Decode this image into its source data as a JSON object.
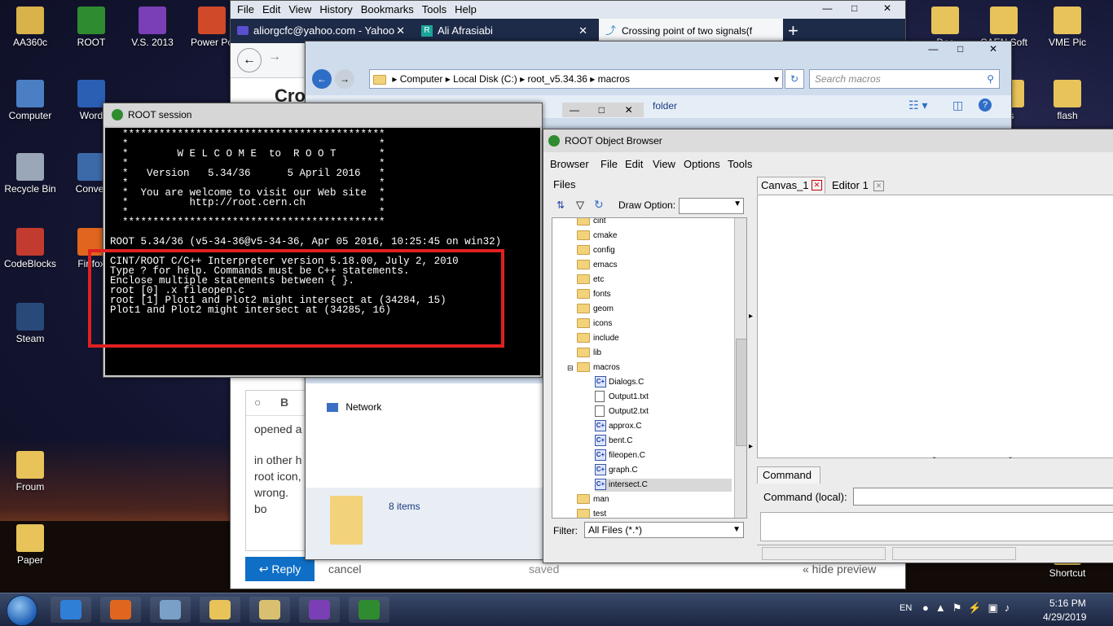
{
  "desktop": {
    "left_icons": [
      {
        "label": "AA360c",
        "color": "#d9b24a"
      },
      {
        "label": "Computer",
        "color": "#4b7fc4"
      },
      {
        "label": "Recycle Bin",
        "color": "#9aa7b8"
      },
      {
        "label": "CodeBlocks",
        "color": "#c23b2e"
      },
      {
        "label": "Steam",
        "color": "#274a7a"
      },
      {
        "label": "Froum",
        "color": "#e7c35a"
      },
      {
        "label": "Paper",
        "color": "#e7c35a"
      }
    ],
    "second_col_icons": [
      {
        "label": "ROOT",
        "color": "#2f8b2f"
      },
      {
        "label": "Word",
        "color": "#2b5fb4"
      },
      {
        "label": "Conver",
        "color": "#3c6aa8"
      },
      {
        "label": "Fir fox",
        "color": "#e0661f"
      }
    ],
    "third_col_icons": [
      {
        "label": "V.S. 2013",
        "color": "#7a3fb4"
      },
      {
        "label": "Power Po",
        "color": "#d04a2a"
      }
    ],
    "right_icons": [
      {
        "label": "Doc",
        "color": "#e7c35a"
      },
      {
        "label": "CAEN Soft",
        "color": "#e7c35a"
      },
      {
        "label": "VME Pic",
        "color": "#e7c35a"
      },
      {
        "label": "flash",
        "color": "#e7c35a"
      },
      {
        "label": "is",
        "color": "#e7c35a"
      },
      {
        "label": "Shortcut",
        "color": "#e7c35a"
      }
    ]
  },
  "taskbar": {
    "lang": "EN",
    "time": "5:16 PM",
    "date": "4/29/2019",
    "apps": [
      {
        "name": "ie-icon",
        "color": "#2f7fd6"
      },
      {
        "name": "firefox-icon",
        "color": "#e0661f"
      },
      {
        "name": "calculator-icon",
        "color": "#7aa0c8"
      },
      {
        "name": "file-explorer-icon",
        "color": "#e7c35a"
      },
      {
        "name": "folders-icon",
        "color": "#d9c070"
      },
      {
        "name": "visual-studio-icon",
        "color": "#7a3fb4"
      },
      {
        "name": "root-tree-icon",
        "color": "#2f8b2f"
      }
    ]
  },
  "browser": {
    "menu": [
      "File",
      "Edit",
      "View",
      "History",
      "Bookmarks",
      "Tools",
      "Help"
    ],
    "tabs": [
      {
        "title": "aliorgcfc@yahoo.com - Yahoo"
      },
      {
        "title": "Ali Afrasiabi"
      },
      {
        "title": "Crossing point of two signals(f"
      }
    ],
    "new_tab": "+",
    "page_title": "Cro",
    "editor_lines": [
      "opened a",
      "in other h",
      "root icon,",
      "wrong. bo"
    ],
    "reply_label": "Reply",
    "cancel_label": "cancel",
    "saved_label": "saved",
    "hide_preview": "« hide preview"
  },
  "explorer": {
    "breadcrumb": [
      "Computer",
      "Local Disk (C:)",
      "root_v5.34.36",
      "macros"
    ],
    "search_placeholder": "Search macros",
    "folder_label": "folder",
    "network_label": "Network",
    "items_count": "8 items"
  },
  "root_session": {
    "title": "ROOT session",
    "banner": [
      "  *******************************************",
      "  *                                         *",
      "  *        W E L C O M E  to  R O O T       *",
      "  *                                         *",
      "  *   Version   5.34/36      5 April 2016   *",
      "  *                                         *",
      "  *  You are welcome to visit our Web site  *",
      "  *          http://root.cern.ch            *",
      "  *                                         *",
      "  *******************************************"
    ],
    "version_line": "ROOT 5.34/36 (v5-34-36@v5-34-36, Apr 05 2016, 10:25:45 on win32)",
    "output": [
      "CINT/ROOT C/C++ Interpreter version 5.18.00, July 2, 2010",
      "Type ? for help. Commands must be C++ statements.",
      "Enclose multiple statements between { }.",
      "root [0] .x fileopen.c",
      "root [1] Plot1 and Plot2 might intersect at (34284, 15)",
      "Plot1 and Plot2 might intersect at (34285, 16)"
    ]
  },
  "object_browser": {
    "title": "ROOT Object Browser",
    "menu": [
      "Browser",
      "File",
      "Edit",
      "View",
      "Options",
      "Tools"
    ],
    "files_tab": "Files",
    "draw_option_label": "Draw Option:",
    "tree": [
      {
        "label": "cint",
        "type": "folder",
        "depth": 1
      },
      {
        "label": "cmake",
        "type": "folder",
        "depth": 1
      },
      {
        "label": "config",
        "type": "folder",
        "depth": 1
      },
      {
        "label": "emacs",
        "type": "folder",
        "depth": 1
      },
      {
        "label": "etc",
        "type": "folder",
        "depth": 1
      },
      {
        "label": "fonts",
        "type": "folder",
        "depth": 1
      },
      {
        "label": "geom",
        "type": "folder",
        "depth": 1
      },
      {
        "label": "icons",
        "type": "folder",
        "depth": 1
      },
      {
        "label": "include",
        "type": "folder",
        "depth": 1
      },
      {
        "label": "lib",
        "type": "folder",
        "depth": 1
      },
      {
        "label": "macros",
        "type": "folder-open",
        "depth": 1
      },
      {
        "label": "Dialogs.C",
        "type": "c",
        "depth": 2
      },
      {
        "label": "Output1.txt",
        "type": "txt",
        "depth": 2
      },
      {
        "label": "Output2.txt",
        "type": "txt",
        "depth": 2
      },
      {
        "label": "approx.C",
        "type": "c",
        "depth": 2
      },
      {
        "label": "bent.C",
        "type": "c",
        "depth": 2
      },
      {
        "label": "fileopen.C",
        "type": "c",
        "depth": 2
      },
      {
        "label": "graph.C",
        "type": "c",
        "depth": 2
      },
      {
        "label": "intersect.C",
        "type": "c",
        "depth": 2,
        "selected": true
      },
      {
        "label": "man",
        "type": "folder",
        "depth": 1
      },
      {
        "label": "test",
        "type": "folder",
        "depth": 1
      }
    ],
    "filter_label": "Filter:",
    "filter_value": "All Files (*.*)",
    "tabs": [
      {
        "label": "Canvas_1"
      },
      {
        "label": "Editor 1"
      }
    ],
    "command_tab": "Command",
    "command_local_label": "Command (local):"
  }
}
